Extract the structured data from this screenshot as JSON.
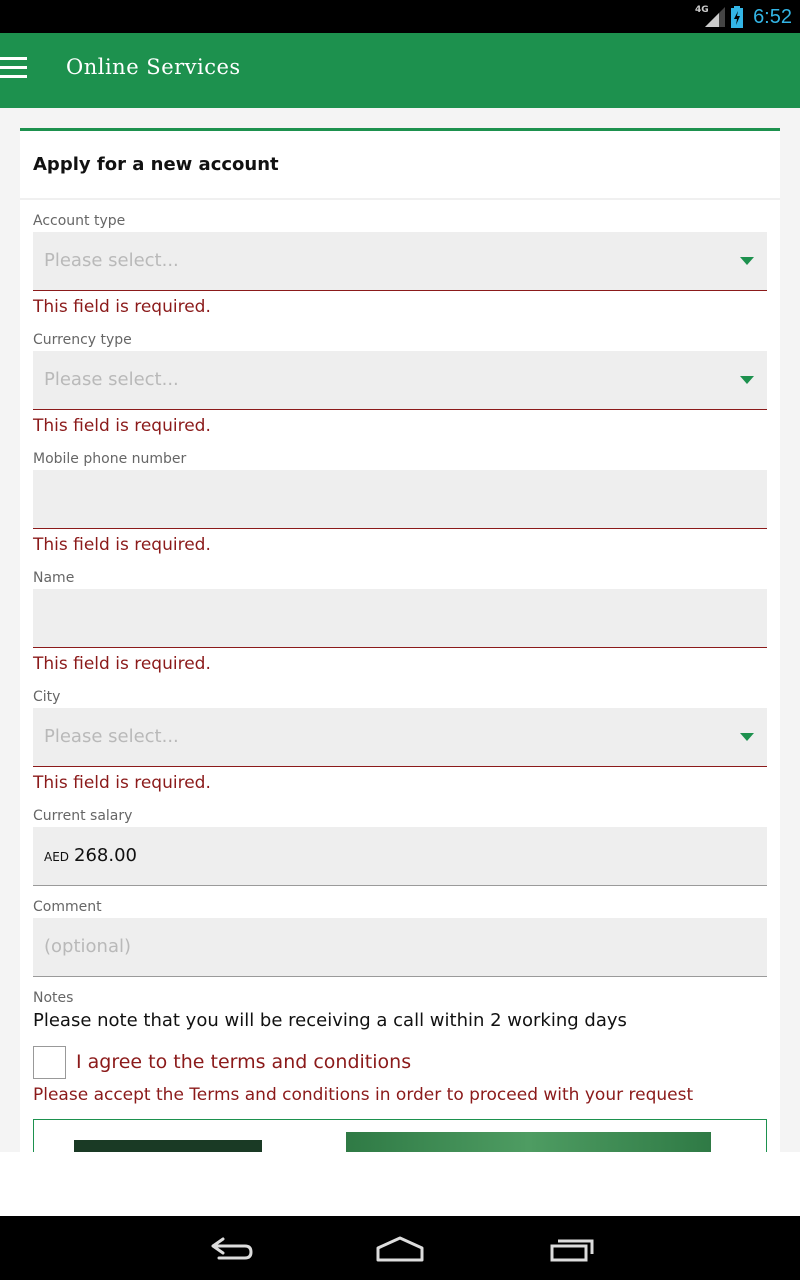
{
  "status_bar": {
    "time": "6:52",
    "network": "4G",
    "icons": [
      "signal-icon",
      "battery-charging-icon"
    ]
  },
  "app_bar": {
    "title": "Online Services",
    "menu_icon": "hamburger-menu-icon"
  },
  "card": {
    "title": "Apply for a new account"
  },
  "form": {
    "account_type": {
      "label": "Account type",
      "placeholder": "Please select...",
      "error": "This field is required."
    },
    "currency_type": {
      "label": "Currency type",
      "placeholder": "Please select...",
      "error": "This field is required."
    },
    "mobile_phone": {
      "label": "Mobile phone number",
      "value": "",
      "error": "This field is required."
    },
    "name": {
      "label": "Name",
      "value": "",
      "error": "This field is required."
    },
    "city": {
      "label": "City",
      "placeholder": "Please select...",
      "error": "This field is required."
    },
    "current_salary": {
      "label": "Current salary",
      "currency": "AED",
      "value": "268.00"
    },
    "comment": {
      "label": "Comment",
      "placeholder": "(optional)"
    },
    "notes": {
      "label": "Notes",
      "text": "Please note that you will be receiving a call within 2 working days"
    },
    "terms": {
      "checked": false,
      "label": "I agree to the terms and conditions",
      "error": "Please accept the Terms and conditions in order to proceed with your request"
    }
  },
  "nav_bar": {
    "back_icon": "back-icon",
    "home_icon": "home-icon",
    "recents_icon": "recent-apps-icon"
  },
  "colors": {
    "primary": "#1d914e",
    "error": "#8b1a1a",
    "status_time": "#33b5e5"
  }
}
